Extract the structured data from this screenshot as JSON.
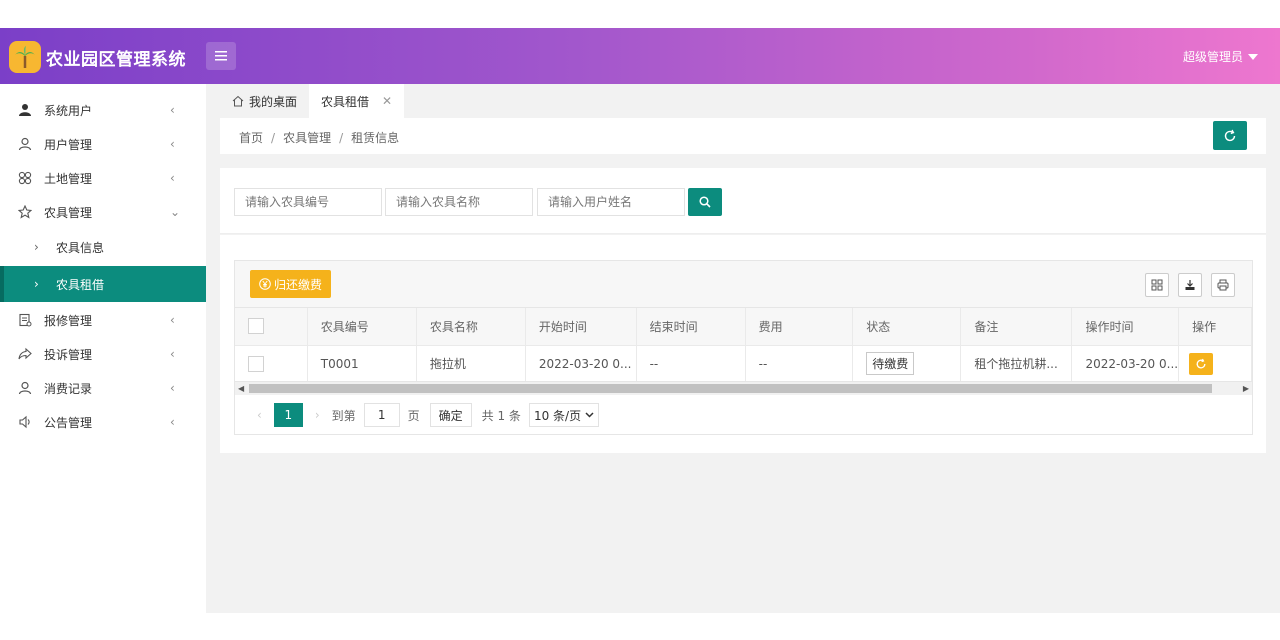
{
  "app": {
    "title": "农业园区管理系统",
    "user": "超级管理员",
    "brand_color": "#0c8c7e",
    "accent_color": "#f5b21b"
  },
  "sidebar": {
    "items": [
      {
        "label": "系统用户",
        "icon": "user-solid-icon"
      },
      {
        "label": "用户管理",
        "icon": "user-outline-icon"
      },
      {
        "label": "土地管理",
        "icon": "clover-icon"
      },
      {
        "label": "农具管理",
        "icon": "star-outline-icon",
        "expanded": true
      }
    ],
    "sub_items": [
      {
        "label": "农具信息"
      },
      {
        "label": "农具租借",
        "active": true
      }
    ],
    "items_after": [
      {
        "label": "报修管理",
        "icon": "report-icon"
      },
      {
        "label": "投诉管理",
        "icon": "share-icon"
      },
      {
        "label": "消费记录",
        "icon": "user-outline-icon"
      },
      {
        "label": "公告管理",
        "icon": "speaker-icon"
      }
    ]
  },
  "tabs": [
    {
      "label": "我的桌面",
      "icon": "home-icon"
    },
    {
      "label": "农具租借",
      "active": true
    }
  ],
  "breadcrumb": [
    "首页",
    "农具管理",
    "租赁信息"
  ],
  "search": {
    "placeholders": [
      "请输入农具编号",
      "请输入农具名称",
      "请输入用户姓名"
    ]
  },
  "toolbar": {
    "return_label": "归还缴费"
  },
  "table": {
    "columns": [
      "农具编号",
      "农具名称",
      "开始时间",
      "结束时间",
      "费用",
      "状态",
      "备注",
      "操作时间",
      "操作"
    ],
    "rows": [
      {
        "code": "T0001",
        "name": "拖拉机",
        "start": "2022-03-20 0...",
        "end": "--",
        "fee": "--",
        "status": "待缴费",
        "remark": "租个拖拉机耕...",
        "op_time": "2022-03-20 0..."
      }
    ]
  },
  "pager": {
    "current": "1",
    "goto_label": "到第",
    "goto_value": "1",
    "page_label": "页",
    "confirm": "确定",
    "total": "共 1 条",
    "page_size": "10 条/页"
  }
}
